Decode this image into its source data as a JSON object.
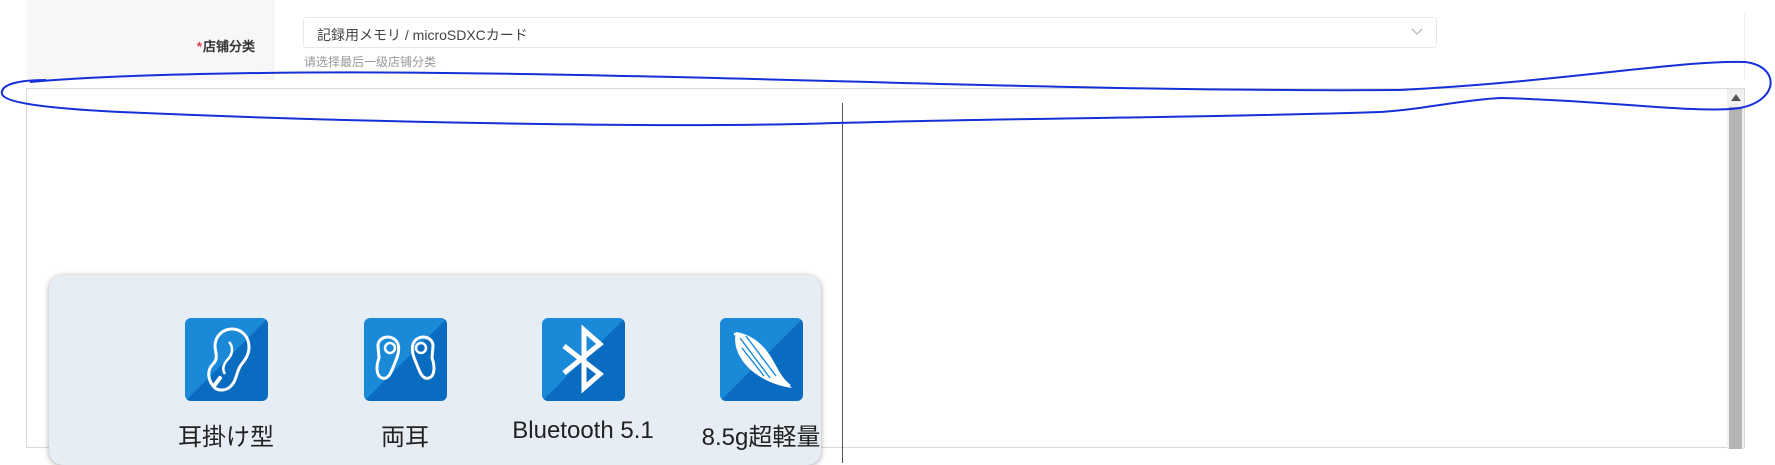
{
  "form": {
    "required_mark": "*",
    "label": "店铺分类",
    "select_value": "記録用メモリ / microSDXCカード",
    "hint": "请选择最后一级店铺分类"
  },
  "features": [
    {
      "icon": "ear-hook-icon",
      "label": "耳掛け型"
    },
    {
      "icon": "earbuds-icon",
      "label": "両耳"
    },
    {
      "icon": "bluetooth-icon",
      "label": "Bluetooth 5.1"
    },
    {
      "icon": "feather-icon",
      "label": "8.5g超軽量"
    }
  ],
  "colors": {
    "required": "#e0393e",
    "icon_blue": "#1a8ad8",
    "card_bg": "#e6edf4",
    "annotation": "#1530d8"
  }
}
